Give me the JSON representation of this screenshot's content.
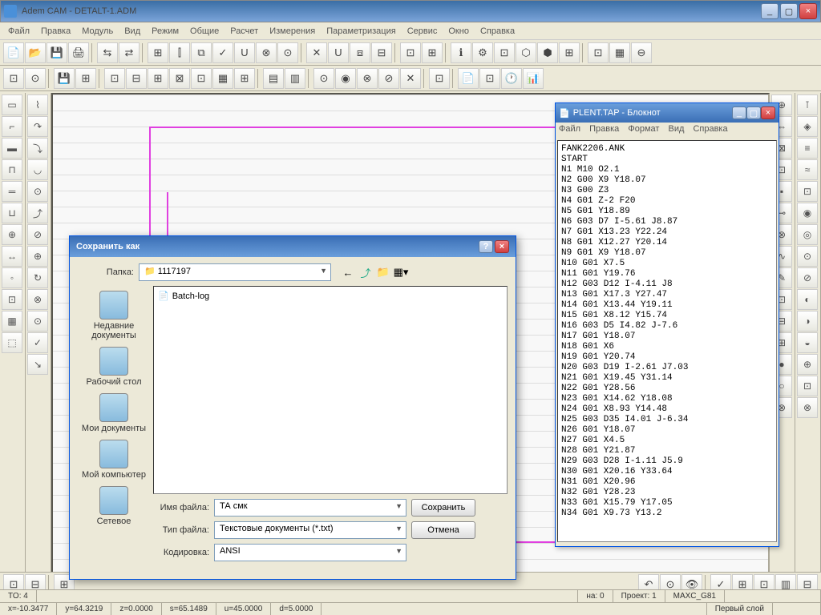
{
  "app": {
    "title": "Adem CAM - DETALT-1.ADM"
  },
  "menu": [
    "Файл",
    "Правка",
    "Модуль",
    "Вид",
    "Режим",
    "Общие",
    "Расчет",
    "Измерения",
    "Параметризация",
    "Сервис",
    "Окно",
    "Справка"
  ],
  "notepad": {
    "title": "PLENT.TAP - Блокнот",
    "menu": [
      "Файл",
      "Правка",
      "Формат",
      "Вид",
      "Справка"
    ],
    "content": "FANK2206.ANK\nSTART\nN1 M10 O2.1\nN2 G00 X9 Y18.07\nN3 G00 Z3\nN4 G01 Z-2 F20\nN5 G01 Y18.89\nN6 G03 D7 I-5.61 J8.87\nN7 G01 X13.23 Y22.24\nN8 G01 X12.27 Y20.14\nN9 G01 X9 Y18.07\nN10 G01 X7.5\nN11 G01 Y19.76\nN12 G03 D12 I-4.11 J8\nN13 G01 X17.3 Y27.47\nN14 G01 X13.44 Y19.11\nN15 G01 X8.12 Y15.74\nN16 G03 D5 I4.82 J-7.6\nN17 G01 Y18.07\nN18 G01 X6\nN19 G01 Y20.74\nN20 G03 D19 I-2.61 J7.03\nN21 G01 X19.45 Y31.14\nN22 G01 Y28.56\nN23 G01 X14.62 Y18.08\nN24 G01 X8.93 Y14.48\nN25 G03 D35 I4.01 J-6.34\nN26 G01 Y18.07\nN27 G01 X4.5\nN28 G01 Y21.87\nN29 G03 D28 I-1.11 J5.9\nN30 G01 X20.16 Y33.64\nN31 G01 X20.96\nN32 G01 Y28.23\nN33 G01 X15.79 Y17.05\nN34 G01 X9.73 Y13.2"
  },
  "savedlg": {
    "title": "Сохранить как",
    "folder_label": "Папка:",
    "folder_value": "1117197",
    "file_item": "Batch-log",
    "places": [
      {
        "label": "Недавние документы"
      },
      {
        "label": "Рабочий стол"
      },
      {
        "label": "Мои документы"
      },
      {
        "label": "Мой компьютер"
      },
      {
        "label": "Сетевое"
      }
    ],
    "filename_label": "Имя файла:",
    "filename_value": "ТА смк",
    "filetype_label": "Тип файла:",
    "filetype_value": "Текстовые документы (*.txt)",
    "encoding_label": "Кодировка:",
    "encoding_value": "ANSI",
    "save_btn": "Сохранить",
    "cancel_btn": "Отмена"
  },
  "status": {
    "to": "TO: 4",
    "na": "на: 0",
    "project": "Проект: 1",
    "maxc": "MAXC_G81",
    "x": "x=-10.3477",
    "y": "y=64.3219",
    "z": "z=0.0000",
    "s": "s=65.1489",
    "u": "u=45.0000",
    "d": "d=5.0000",
    "layer": "Первый слой"
  }
}
